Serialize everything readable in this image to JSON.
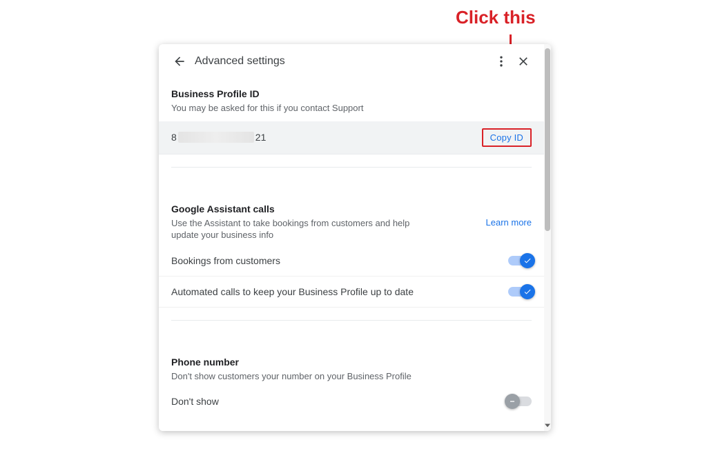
{
  "annotation": {
    "text": "Click this"
  },
  "header": {
    "title": "Advanced settings"
  },
  "sections": {
    "profile_id": {
      "title": "Business Profile ID",
      "desc": "You may be asked for this if you contact Support",
      "id_prefix": "8",
      "id_suffix": "21",
      "copy_label": "Copy ID"
    },
    "assistant": {
      "title": "Google Assistant calls",
      "desc": "Use the Assistant to take bookings from customers and help update your business info",
      "learn_more": "Learn more",
      "row1": "Bookings from customers",
      "row2": "Automated calls to keep your Business Profile up to date"
    },
    "phone": {
      "title": "Phone number",
      "desc": "Don't show customers your number on your Business Profile",
      "row1": "Don't show"
    }
  }
}
